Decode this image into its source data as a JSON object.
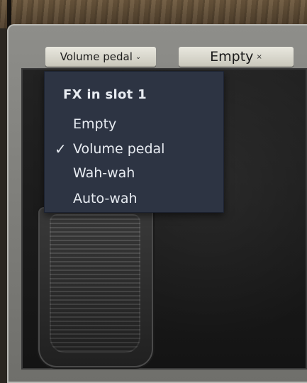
{
  "slots": {
    "slot1_label": "Volume pedal",
    "slot2_label": "Empty",
    "slot1_caret": "⌄",
    "slot2_caret": "×"
  },
  "menu": {
    "title": "FX in slot 1",
    "items": [
      {
        "label": "Empty",
        "checked": false
      },
      {
        "label": "Volume pedal",
        "checked": true
      },
      {
        "label": "Wah-wah",
        "checked": false
      },
      {
        "label": "Auto-wah",
        "checked": false
      }
    ],
    "check_glyph": "✓"
  },
  "colors": {
    "menu_bg": "#2d3443",
    "menu_text": "#e8ecf2",
    "slot_bg": "#d9d7cc"
  }
}
